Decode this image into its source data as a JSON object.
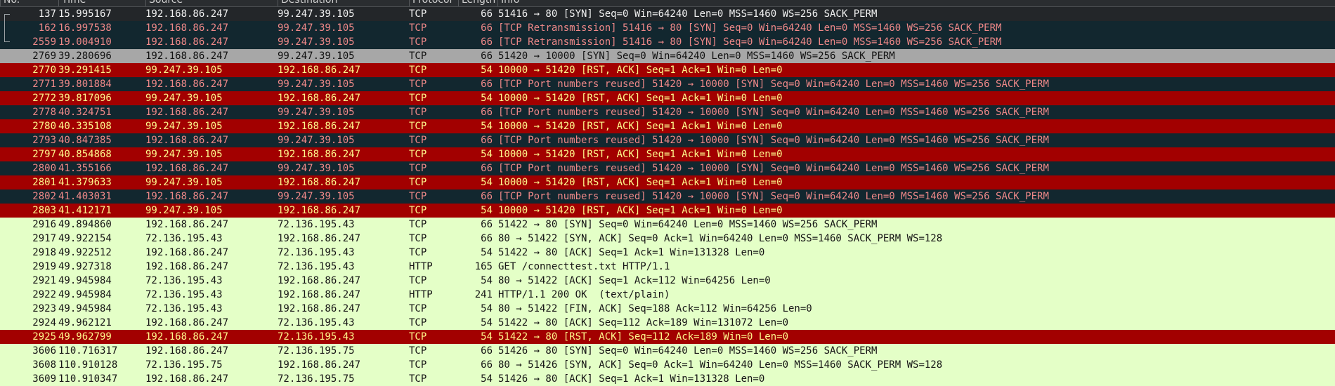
{
  "columns": {
    "no": "No.",
    "time": "Time",
    "source": "Source",
    "destination": "Destination",
    "protocol": "Protocol",
    "length": "Length",
    "info": "Info"
  },
  "packets": [
    {
      "no": "137",
      "time": "15.995167",
      "src": "192.168.86.247",
      "dst": "99.247.39.105",
      "proto": "TCP",
      "len": "66",
      "info": "51416 → 80 [SYN] Seq=0 Win=64240 Len=0 MSS=1460 WS=256 SACK_PERM"
    },
    {
      "no": "162",
      "time": "16.997538",
      "src": "192.168.86.247",
      "dst": "99.247.39.105",
      "proto": "TCP",
      "len": "66",
      "info": "[TCP Retransmission] 51416 → 80 [SYN] Seq=0 Win=64240 Len=0 MSS=1460 WS=256 SACK_PERM"
    },
    {
      "no": "2559",
      "time": "19.004910",
      "src": "192.168.86.247",
      "dst": "99.247.39.105",
      "proto": "TCP",
      "len": "66",
      "info": "[TCP Retransmission] 51416 → 80 [SYN] Seq=0 Win=64240 Len=0 MSS=1460 WS=256 SACK_PERM"
    },
    {
      "no": "2769",
      "time": "39.280696",
      "src": "192.168.86.247",
      "dst": "99.247.39.105",
      "proto": "TCP",
      "len": "66",
      "info": "51420 → 10000 [SYN] Seq=0 Win=64240 Len=0 MSS=1460 WS=256 SACK_PERM"
    },
    {
      "no": "2770",
      "time": "39.291415",
      "src": "99.247.39.105",
      "dst": "192.168.86.247",
      "proto": "TCP",
      "len": "54",
      "info": "10000 → 51420 [RST, ACK] Seq=1 Ack=1 Win=0 Len=0"
    },
    {
      "no": "2771",
      "time": "39.801884",
      "src": "192.168.86.247",
      "dst": "99.247.39.105",
      "proto": "TCP",
      "len": "66",
      "info": "[TCP Port numbers reused] 51420 → 10000 [SYN] Seq=0 Win=64240 Len=0 MSS=1460 WS=256 SACK_PERM"
    },
    {
      "no": "2772",
      "time": "39.817096",
      "src": "99.247.39.105",
      "dst": "192.168.86.247",
      "proto": "TCP",
      "len": "54",
      "info": "10000 → 51420 [RST, ACK] Seq=1 Ack=1 Win=0 Len=0"
    },
    {
      "no": "2778",
      "time": "40.324751",
      "src": "192.168.86.247",
      "dst": "99.247.39.105",
      "proto": "TCP",
      "len": "66",
      "info": "[TCP Port numbers reused] 51420 → 10000 [SYN] Seq=0 Win=64240 Len=0 MSS=1460 WS=256 SACK_PERM"
    },
    {
      "no": "2780",
      "time": "40.335108",
      "src": "99.247.39.105",
      "dst": "192.168.86.247",
      "proto": "TCP",
      "len": "54",
      "info": "10000 → 51420 [RST, ACK] Seq=1 Ack=1 Win=0 Len=0"
    },
    {
      "no": "2793",
      "time": "40.847385",
      "src": "192.168.86.247",
      "dst": "99.247.39.105",
      "proto": "TCP",
      "len": "66",
      "info": "[TCP Port numbers reused] 51420 → 10000 [SYN] Seq=0 Win=64240 Len=0 MSS=1460 WS=256 SACK_PERM"
    },
    {
      "no": "2797",
      "time": "40.854868",
      "src": "99.247.39.105",
      "dst": "192.168.86.247",
      "proto": "TCP",
      "len": "54",
      "info": "10000 → 51420 [RST, ACK] Seq=1 Ack=1 Win=0 Len=0"
    },
    {
      "no": "2800",
      "time": "41.355166",
      "src": "192.168.86.247",
      "dst": "99.247.39.105",
      "proto": "TCP",
      "len": "66",
      "info": "[TCP Port numbers reused] 51420 → 10000 [SYN] Seq=0 Win=64240 Len=0 MSS=1460 WS=256 SACK_PERM"
    },
    {
      "no": "2801",
      "time": "41.379633",
      "src": "99.247.39.105",
      "dst": "192.168.86.247",
      "proto": "TCP",
      "len": "54",
      "info": "10000 → 51420 [RST, ACK] Seq=1 Ack=1 Win=0 Len=0"
    },
    {
      "no": "2802",
      "time": "41.403031",
      "src": "192.168.86.247",
      "dst": "99.247.39.105",
      "proto": "TCP",
      "len": "66",
      "info": "[TCP Port numbers reused] 51420 → 10000 [SYN] Seq=0 Win=64240 Len=0 MSS=1460 WS=256 SACK_PERM"
    },
    {
      "no": "2803",
      "time": "41.412171",
      "src": "99.247.39.105",
      "dst": "192.168.86.247",
      "proto": "TCP",
      "len": "54",
      "info": "10000 → 51420 [RST, ACK] Seq=1 Ack=1 Win=0 Len=0"
    },
    {
      "no": "2916",
      "time": "49.894860",
      "src": "192.168.86.247",
      "dst": "72.136.195.43",
      "proto": "TCP",
      "len": "66",
      "info": "51422 → 80 [SYN] Seq=0 Win=64240 Len=0 MSS=1460 WS=256 SACK_PERM"
    },
    {
      "no": "2917",
      "time": "49.922154",
      "src": "72.136.195.43",
      "dst": "192.168.86.247",
      "proto": "TCP",
      "len": "66",
      "info": "80 → 51422 [SYN, ACK] Seq=0 Ack=1 Win=64240 Len=0 MSS=1460 SACK_PERM WS=128"
    },
    {
      "no": "2918",
      "time": "49.922512",
      "src": "192.168.86.247",
      "dst": "72.136.195.43",
      "proto": "TCP",
      "len": "54",
      "info": "51422 → 80 [ACK] Seq=1 Ack=1 Win=131328 Len=0"
    },
    {
      "no": "2919",
      "time": "49.927318",
      "src": "192.168.86.247",
      "dst": "72.136.195.43",
      "proto": "HTTP",
      "len": "165",
      "info": "GET /connecttest.txt HTTP/1.1"
    },
    {
      "no": "2921",
      "time": "49.945984",
      "src": "72.136.195.43",
      "dst": "192.168.86.247",
      "proto": "TCP",
      "len": "54",
      "info": "80 → 51422 [ACK] Seq=1 Ack=112 Win=64256 Len=0"
    },
    {
      "no": "2922",
      "time": "49.945984",
      "src": "72.136.195.43",
      "dst": "192.168.86.247",
      "proto": "HTTP",
      "len": "241",
      "info": "HTTP/1.1 200 OK  (text/plain)"
    },
    {
      "no": "2923",
      "time": "49.945984",
      "src": "72.136.195.43",
      "dst": "192.168.86.247",
      "proto": "TCP",
      "len": "54",
      "info": "80 → 51422 [FIN, ACK] Seq=188 Ack=112 Win=64256 Len=0"
    },
    {
      "no": "2924",
      "time": "49.962121",
      "src": "192.168.86.247",
      "dst": "72.136.195.43",
      "proto": "TCP",
      "len": "54",
      "info": "51422 → 80 [ACK] Seq=112 Ack=189 Win=131072 Len=0"
    },
    {
      "no": "2925",
      "time": "49.962799",
      "src": "192.168.86.247",
      "dst": "72.136.195.43",
      "proto": "TCP",
      "len": "54",
      "info": "51422 → 80 [RST, ACK] Seq=112 Ack=189 Win=0 Len=0"
    },
    {
      "no": "3606",
      "time": "110.716317",
      "src": "192.168.86.247",
      "dst": "72.136.195.75",
      "proto": "TCP",
      "len": "66",
      "info": "51426 → 80 [SYN] Seq=0 Win=64240 Len=0 MSS=1460 WS=256 SACK_PERM"
    },
    {
      "no": "3608",
      "time": "110.910128",
      "src": "72.136.195.75",
      "dst": "192.168.86.247",
      "proto": "TCP",
      "len": "66",
      "info": "80 → 51426 [SYN, ACK] Seq=0 Ack=1 Win=64240 Len=0 MSS=1460 SACK_PERM WS=128"
    },
    {
      "no": "3609",
      "time": "110.910347",
      "src": "192.168.86.247",
      "dst": "72.136.195.75",
      "proto": "TCP",
      "len": "54",
      "info": "51426 → 80 [ACK] Seq=1 Ack=1 Win=131328 Len=0"
    }
  ],
  "row_styles": [
    "first",
    "teal",
    "teal",
    "selected",
    "red",
    "teal",
    "red",
    "teal",
    "red",
    "teal",
    "red",
    "teal",
    "red",
    "teal",
    "red",
    "green",
    "green",
    "green",
    "green",
    "green",
    "green",
    "green",
    "green",
    "red",
    "green",
    "green",
    "green"
  ],
  "colors": {
    "header_bg": "#2a2d30",
    "rst_bg": "#a20000",
    "rst_fg": "#fff88c",
    "bad_tcp_bg": "#12272f",
    "bad_tcp_fg": "#ee8888",
    "selected_bg": "#a7a7a7",
    "normal_bg": "#e4ffc7"
  }
}
